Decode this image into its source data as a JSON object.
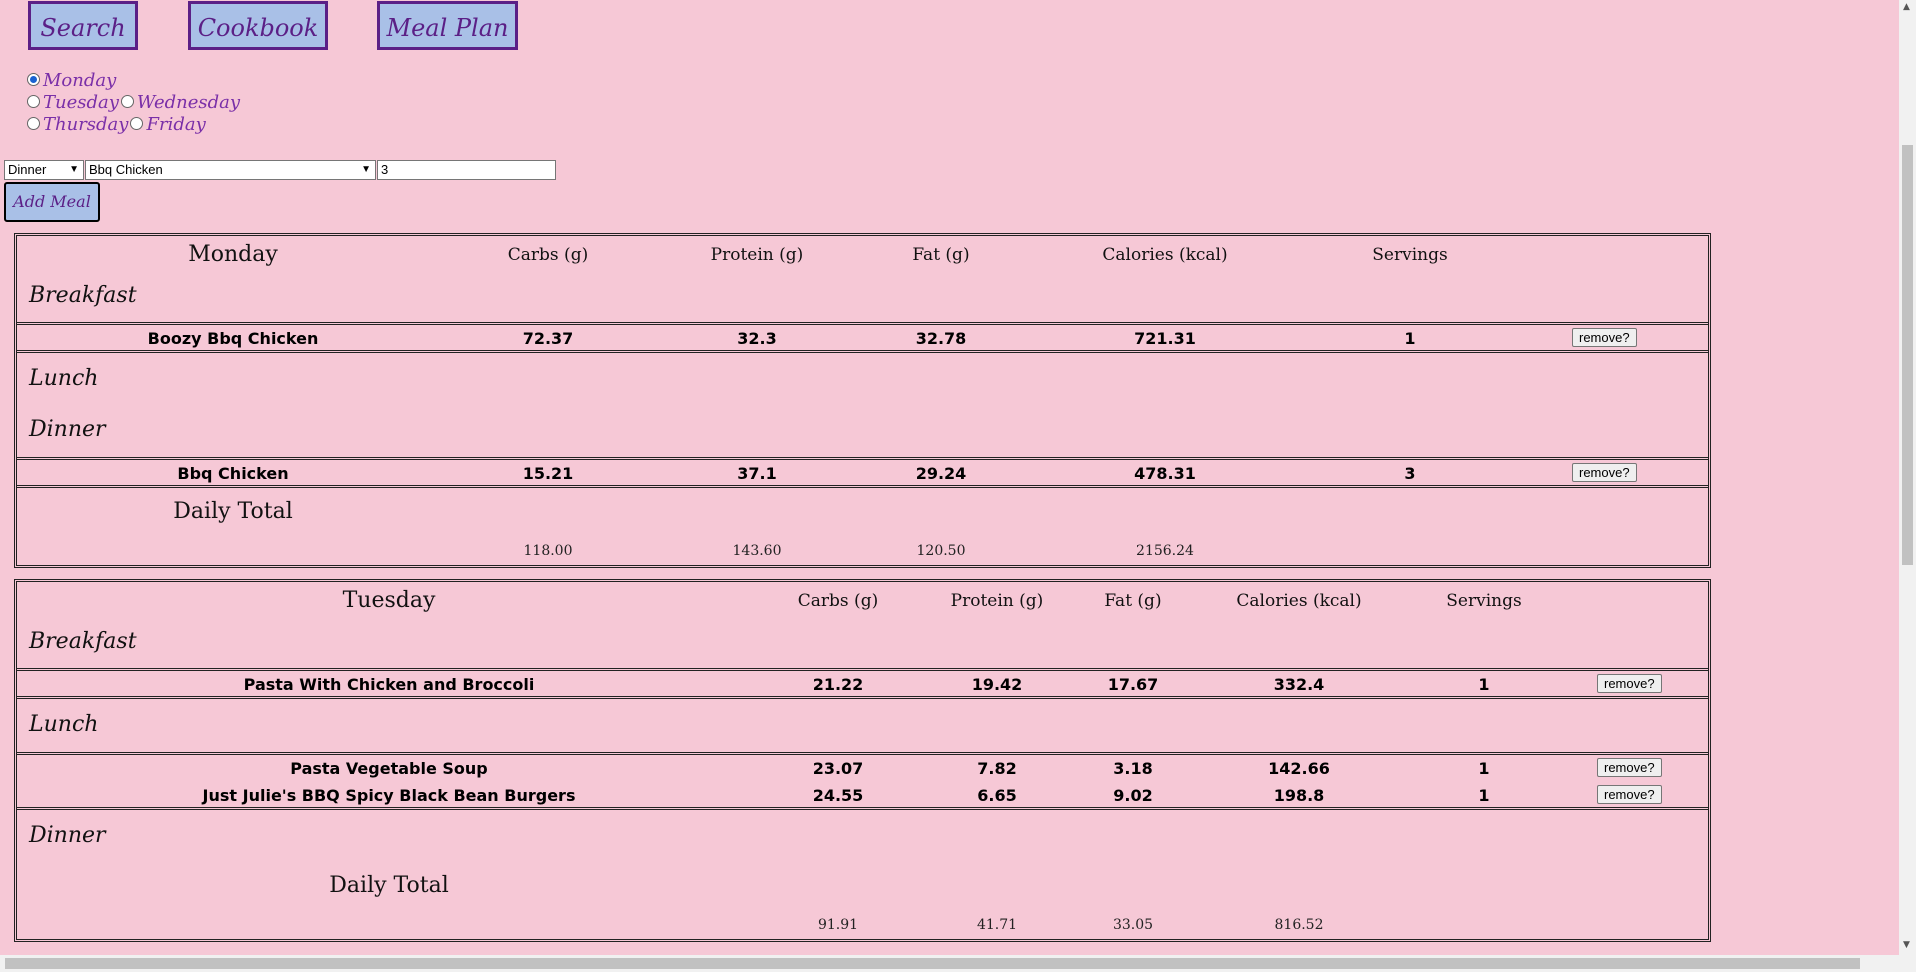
{
  "nav": {
    "search": "Search",
    "cookbook": "Cookbook",
    "meal_plan": "Meal Plan"
  },
  "days_selector": {
    "monday": "Monday",
    "tuesday": "Tuesday",
    "wednesday": "Wednesday",
    "thursday": "Thursday",
    "friday": "Friday",
    "selected": "Monday"
  },
  "controls": {
    "meal_type": "Dinner",
    "recipe": "Bbq Chicken",
    "servings": "3",
    "add_label": "Add Meal"
  },
  "headers": {
    "carbs": "Carbs (g)",
    "protein": "Protein (g)",
    "fat": "Fat (g)",
    "calories": "Calories (kcal)",
    "servings": "Servings"
  },
  "labels": {
    "breakfast": "Breakfast",
    "lunch": "Lunch",
    "dinner": "Dinner",
    "daily_total": "Daily Total",
    "remove": "remove?"
  },
  "monday": {
    "title": "Monday",
    "breakfast": [
      {
        "name": "Boozy Bbq Chicken",
        "carbs": "72.37",
        "protein": "32.3",
        "fat": "32.78",
        "calories": "721.31",
        "servings": "1"
      }
    ],
    "dinner": [
      {
        "name": "Bbq Chicken",
        "carbs": "15.21",
        "protein": "37.1",
        "fat": "29.24",
        "calories": "478.31",
        "servings": "3"
      }
    ],
    "total": {
      "carbs": "118.00",
      "protein": "143.60",
      "fat": "120.50",
      "calories": "2156.24"
    }
  },
  "tuesday": {
    "title": "Tuesday",
    "breakfast": [
      {
        "name": "Pasta With Chicken and Broccoli",
        "carbs": "21.22",
        "protein": "19.42",
        "fat": "17.67",
        "calories": "332.4",
        "servings": "1"
      }
    ],
    "lunch": [
      {
        "name": "Pasta Vegetable Soup",
        "carbs": "23.07",
        "protein": "7.82",
        "fat": "3.18",
        "calories": "142.66",
        "servings": "1"
      },
      {
        "name": "Just Julie's BBQ Spicy Black Bean Burgers",
        "carbs": "24.55",
        "protein": "6.65",
        "fat": "9.02",
        "calories": "198.8",
        "servings": "1"
      }
    ],
    "total": {
      "carbs": "91.91",
      "protein": "41.71",
      "fat": "33.05",
      "calories": "816.52"
    }
  }
}
